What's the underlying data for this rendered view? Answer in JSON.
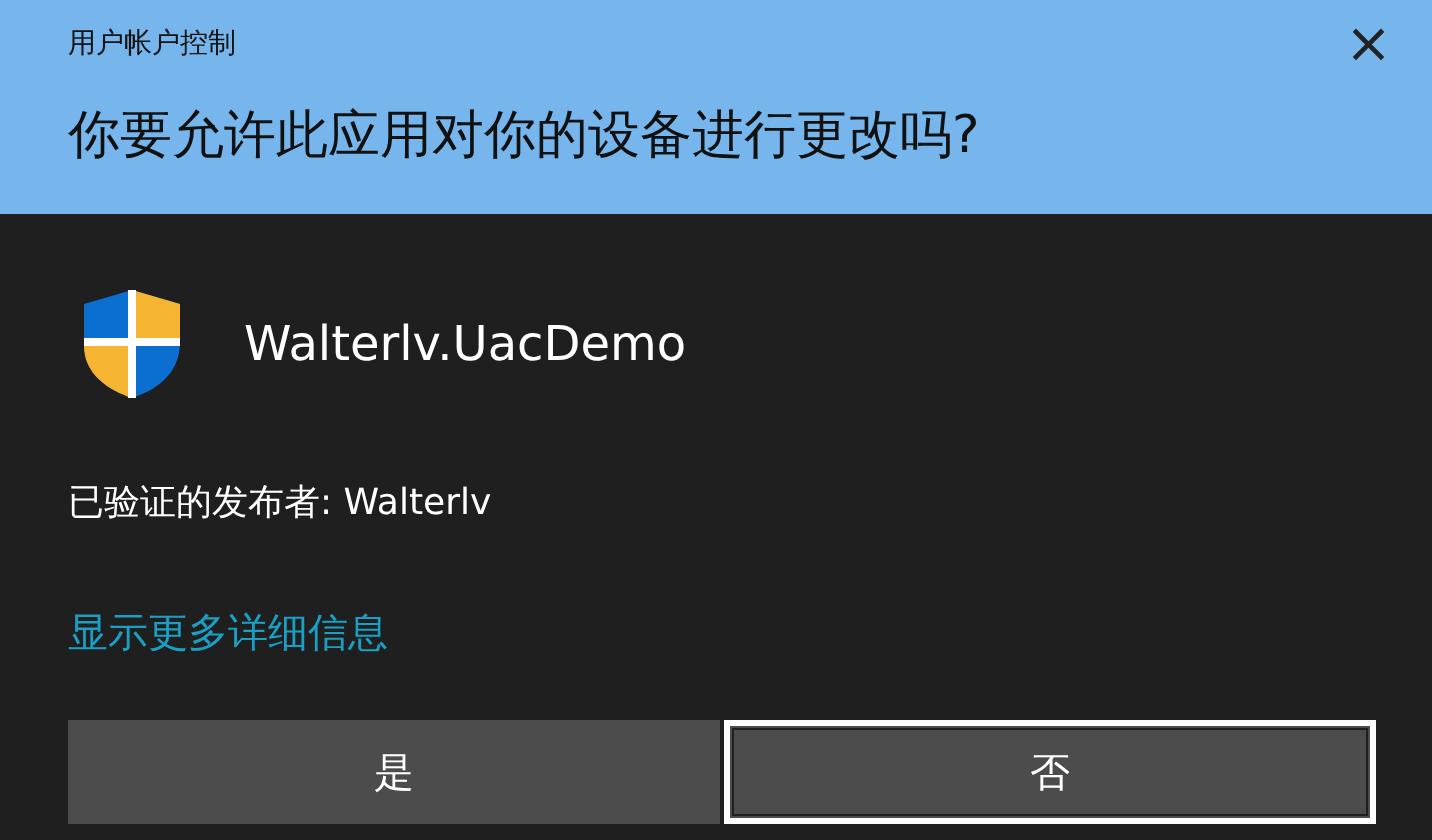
{
  "window": {
    "title": "用户帐户控制",
    "close": "×"
  },
  "question": "你要允许此应用对你的设备进行更改吗?",
  "app": {
    "name": "Walterlv.UacDemo"
  },
  "publisher": "已验证的发布者: Walterlv",
  "details_link": "显示更多详细信息",
  "buttons": [
    {
      "label": "是",
      "focused": false
    },
    {
      "label": "否",
      "focused": true
    }
  ]
}
